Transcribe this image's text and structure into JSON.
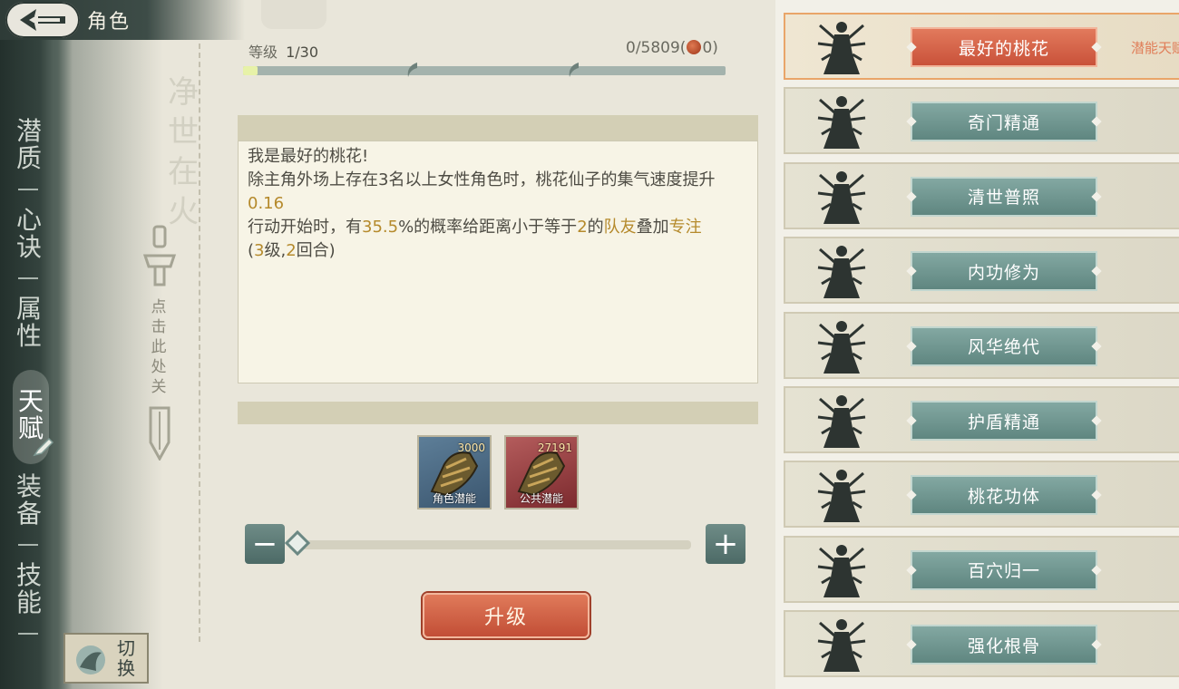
{
  "header": {
    "title": "角色"
  },
  "nav": {
    "items": [
      {
        "id": "qianzhi",
        "label": "潜质"
      },
      {
        "id": "xinjue",
        "label": "心诀"
      },
      {
        "id": "shuxing",
        "label": "属性"
      },
      {
        "id": "tianfu",
        "label": "天赋",
        "active": true
      },
      {
        "id": "zhuangbei",
        "label": "装备"
      },
      {
        "id": "jineng",
        "label": "技能"
      }
    ],
    "switch_label": "切换"
  },
  "close_hint": "点击此处关",
  "level": {
    "label": "等级",
    "value": "1/30",
    "progress_fraction": 0.03
  },
  "exp": {
    "value": "0/5809(",
    "coin_count": "0)"
  },
  "description": {
    "title": "我是最好的桃花!",
    "line1": "除主角外场上存在3名以上女性角色时，桃花仙子的集气速度提升",
    "line1_value": "0.16",
    "line2_pre": "行动开始时，有",
    "line2_pct": "35.5",
    "line2_mid": "%的概率给距离小于等于",
    "line2_dist": "2",
    "line2_of": "的",
    "line2_ally": "队友",
    "line2_add": "叠加",
    "line2_buff": "专注",
    "line3_open": "(",
    "line3_lv": "3",
    "line3_mid": "级,",
    "line3_turns": "2",
    "line3_close": "回合)"
  },
  "potentials": [
    {
      "name": "角色潜能",
      "count": "3000",
      "color": "#4b6a86"
    },
    {
      "name": "公共潜能",
      "count": "27191",
      "color": "#9a4142"
    }
  ],
  "slider": {
    "minus": "−",
    "plus": "+",
    "value_fraction": 0
  },
  "upgrade_label": "升级",
  "talents": [
    {
      "name": "最好的桃花",
      "selected": true,
      "note": "潜能天赋"
    },
    {
      "name": "奇门精通"
    },
    {
      "name": "清世普照"
    },
    {
      "name": "内功修为"
    },
    {
      "name": "风华绝代"
    },
    {
      "name": "护盾精通"
    },
    {
      "name": "桃花功体"
    },
    {
      "name": "百穴归一"
    },
    {
      "name": "强化根骨"
    }
  ],
  "colors": {
    "accent": "#c9523a",
    "teal": "#5f8680",
    "highlight": "#b58a2c"
  }
}
